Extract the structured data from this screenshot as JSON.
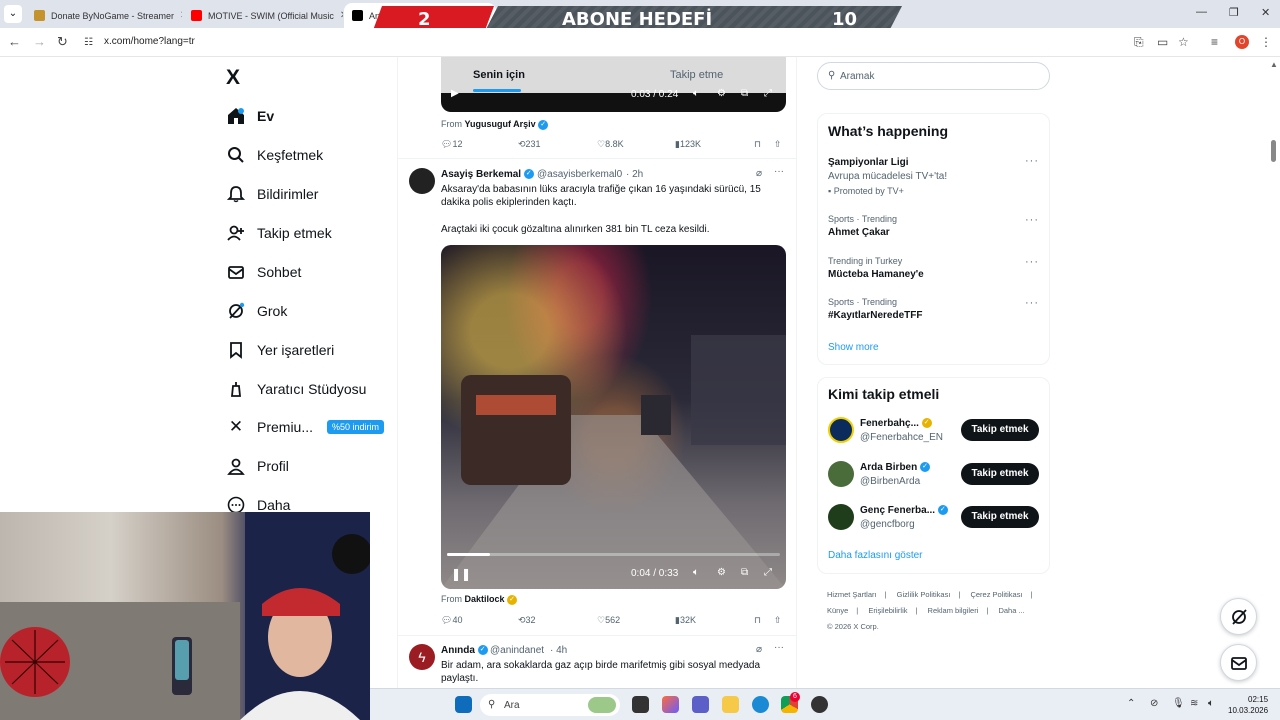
{
  "browser": {
    "tabs": [
      {
        "title": "Donate ByNoGame - Streamer",
        "fav_color": "#c4932e"
      },
      {
        "title": "MOTIVE - SWIM (Official Music",
        "fav_color": "#ff0000"
      },
      {
        "title": "Anasayfa / X",
        "fav_color": "#000000"
      }
    ],
    "new_tab": "+",
    "url": "x.com/home?lang=tr",
    "profile_initial": "O"
  },
  "overlay": {
    "current": "2",
    "label": "ABONE HEDEFİ",
    "goal": "10"
  },
  "sidebar": {
    "logo": "X",
    "items": [
      {
        "label": "Ev",
        "icon": "home-icon"
      },
      {
        "label": "Keşfetmek",
        "icon": "search-icon"
      },
      {
        "label": "Bildirimler",
        "icon": "bell-icon"
      },
      {
        "label": "Takip etmek",
        "icon": "follow-icon"
      },
      {
        "label": "Sohbet",
        "icon": "mail-icon"
      },
      {
        "label": "Grok",
        "icon": "grok-icon"
      },
      {
        "label": "Yer işaretleri",
        "icon": "bookmark-icon"
      },
      {
        "label": "Yaratıcı Stüdyosu",
        "icon": "studio-icon"
      },
      {
        "label": "Premiu...",
        "icon": "x-icon"
      },
      {
        "label": "Profil",
        "icon": "profile-icon"
      },
      {
        "label": "Daha",
        "icon": "more-icon"
      }
    ],
    "premium_badge": "%50 indirim"
  },
  "feed": {
    "tabs": [
      "Senin için",
      "Takip etme"
    ],
    "posts": [
      {
        "video_time": "0:03 / 0:24",
        "from_label": "From",
        "from_name": "Yugusuguf Arşiv",
        "stats": {
          "replies": "12",
          "reposts": "231",
          "likes": "8.8K",
          "views": "123K"
        }
      },
      {
        "name": "Asayiş Berkemal",
        "handle": "@asayisberkemal0",
        "time": "· 2h",
        "text1": "Aksaray'da babasının lüks aracıyla trafiğe çıkan 16 yaşındaki sürücü, 15 dakika polis ekiplerinden kaçtı.",
        "text2": "Araçtaki iki çocuk gözaltına alınırken 381 bin TL ceza kesildi.",
        "video_time": "0:04 / 0:33",
        "video_progress": 0.13,
        "from_label": "From",
        "from_name": "Daktilock",
        "stats": {
          "replies": "40",
          "reposts": "32",
          "likes": "562",
          "views": "32K"
        }
      },
      {
        "name": "Anında",
        "handle": "@anindanet",
        "time": "· 4h",
        "text1": "Bir adam, ara sokaklarda gaz açıp birde marifetmiş gibi sosyal medyada paylaştı."
      }
    ]
  },
  "right": {
    "search_placeholder": "Aramak",
    "happening": {
      "title": "What’s happening",
      "trends": [
        {
          "meta": "",
          "title": "Şampiyonlar Ligi",
          "sub": "Avrupa mücadelesi TV+'ta!",
          "promo": "Promoted by TV+"
        },
        {
          "meta": "Sports · Trending",
          "title": "Ahmet Çakar"
        },
        {
          "meta": "Trending in Turkey",
          "title": "Mücteba Hamaney'e"
        },
        {
          "meta": "Sports · Trending",
          "title": "#KayıtlarNeredeTFF"
        }
      ],
      "show_more": "Show more"
    },
    "who_to_follow": {
      "title": "Kimi takip etmeli",
      "accounts": [
        {
          "name": "Fenerbahç...",
          "handle": "@Fenerbahce_EN",
          "button": "Takip etmek"
        },
        {
          "name": "Arda Birben",
          "handle": "@BirbenArda",
          "button": "Takip etmek"
        },
        {
          "name": "Genç Fenerba...",
          "handle": "@gencfborg",
          "button": "Takip etmek"
        }
      ],
      "show_more": "Daha fazlasını göster"
    },
    "footer": [
      "Hizmet Şartları",
      "|",
      "Gizlilik Politikası",
      "|",
      "Çerez Politikası",
      "|",
      "Künye",
      "|",
      "Erişilebilirlik",
      "|",
      "Reklam bilgileri",
      "|",
      "Daha ...",
      "© 2026 X Corp."
    ]
  },
  "taskbar": {
    "search": "Ara",
    "time": "02:15",
    "date": "10.03.2026",
    "chrome_badge": "6"
  }
}
